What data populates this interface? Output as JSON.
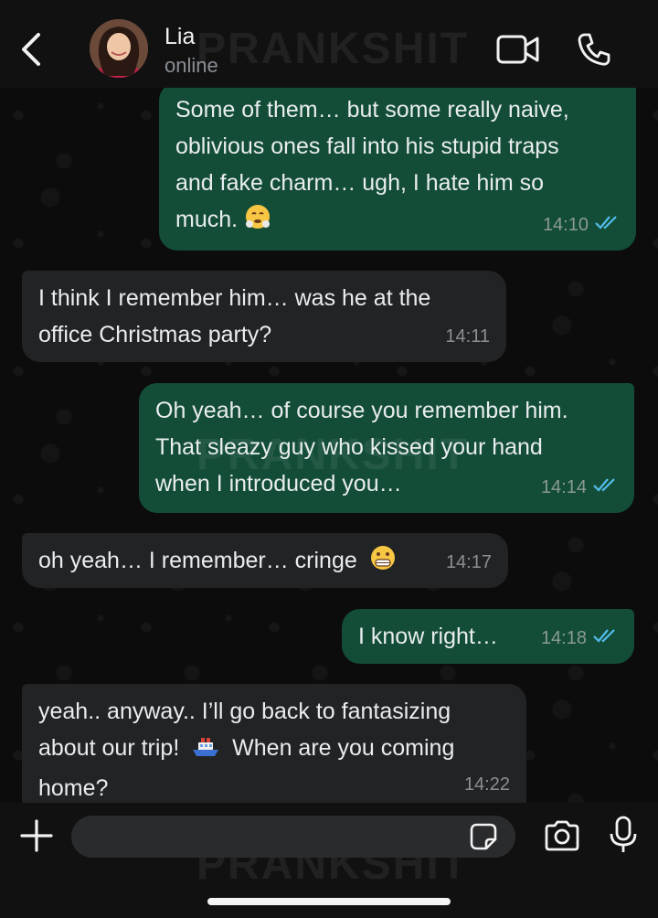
{
  "header": {
    "contact_name": "Lia",
    "status": "online"
  },
  "watermark": "PRANKSHIT",
  "messages": [
    {
      "direction": "out",
      "text": "Some of them… but some really naive,\noblivious ones fall into his stupid traps\nand fake charm… ugh, I hate him so\nmuch.",
      "emoji": "face-with-steam-from-nose",
      "time": "14:10",
      "status": "read"
    },
    {
      "direction": "in",
      "text": "I think I remember him… was he at the\noffice Christmas party?",
      "time": "14:11"
    },
    {
      "direction": "out",
      "text": "Oh yeah… of course you remember him.\nThat sleazy guy who kissed your hand\nwhen I introduced you…",
      "time": "14:14",
      "status": "read"
    },
    {
      "direction": "in",
      "text": "oh yeah… I remember… cringe",
      "emoji": "grimacing-face",
      "time": "14:17"
    },
    {
      "direction": "out",
      "text": "I know right…",
      "time": "14:18",
      "status": "read"
    },
    {
      "direction": "in",
      "text_before_emoji": "yeah.. anyway.. I’ll go back to fantasizing\nabout our trip!",
      "emoji": "ship",
      "text_after_emoji": "When are you coming\nhome?",
      "time": "14:22"
    }
  ],
  "input": {
    "placeholder": ""
  },
  "colors": {
    "outgoing_bubble": "#134d37",
    "incoming_bubble": "#222324",
    "read_ticks": "#53bdeb",
    "background": "#0c0c0c"
  },
  "icons": [
    "back-icon",
    "video-call-icon",
    "phone-icon",
    "plus-icon",
    "sticker-icon",
    "camera-icon",
    "microphone-icon"
  ]
}
